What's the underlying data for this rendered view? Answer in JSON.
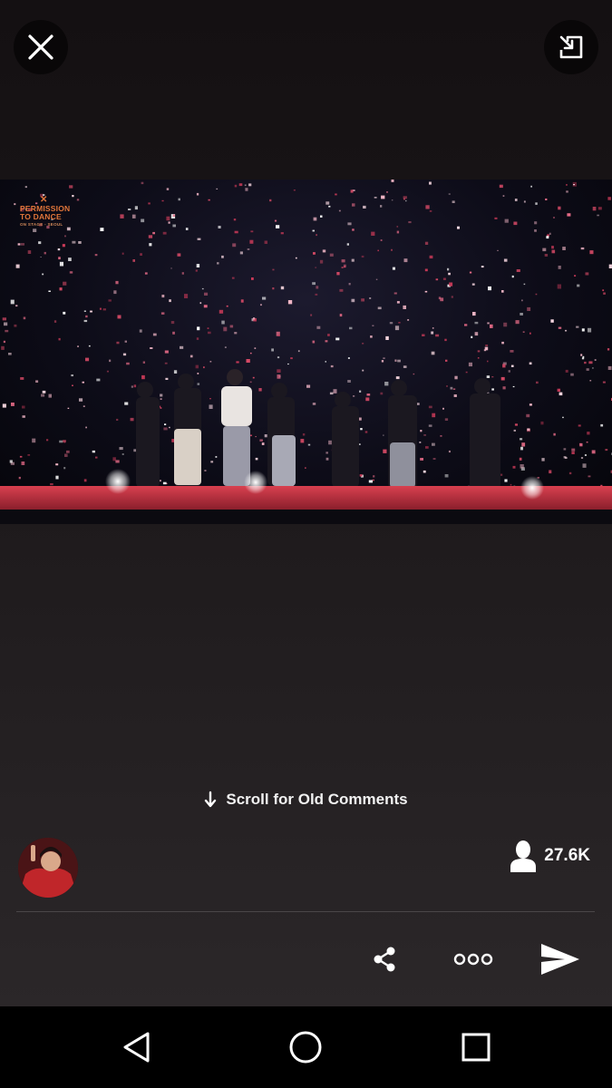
{
  "top_bar": {
    "close_icon": "close-icon",
    "minimize_icon": "picture-in-picture-icon"
  },
  "video": {
    "logo_line1": "PERMISSION",
    "logo_line2": "TO DANCE",
    "logo_line3": "ON STAGE - SEOUL"
  },
  "comments": {
    "scroll_hint": "Scroll for Old Comments",
    "scroll_icon": "arrow-down-icon"
  },
  "host": {
    "avatar_icon": "avatar"
  },
  "viewers": {
    "icon": "person-icon",
    "count": "27.6K"
  },
  "actions": {
    "share_icon": "share-icon",
    "more_icon": "more-horizontal-icon",
    "send_icon": "send-icon"
  },
  "system_nav": {
    "back_icon": "back-triangle-icon",
    "home_icon": "home-circle-icon",
    "recents_icon": "recents-square-icon"
  },
  "colors": {
    "background": "#1a1618",
    "text": "#ffffff",
    "logo_orange": "#e2763a",
    "stage_red": "#c03047"
  }
}
